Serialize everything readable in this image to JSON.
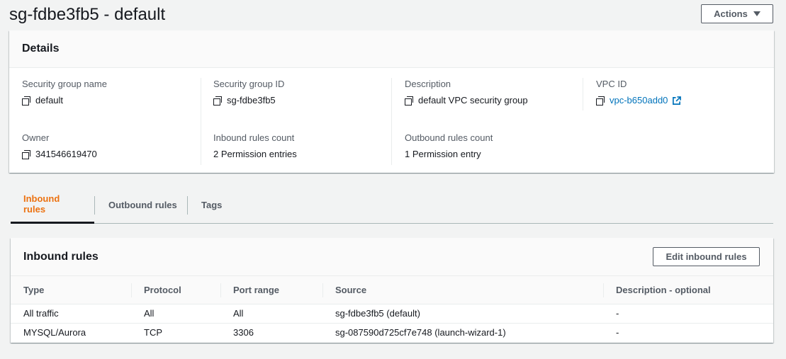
{
  "header": {
    "title": "sg-fdbe3fb5 - default",
    "actions_label": "Actions"
  },
  "details": {
    "title": "Details",
    "fields": [
      {
        "label": "Security group name",
        "value": "default"
      },
      {
        "label": "Security group ID",
        "value": "sg-fdbe3fb5"
      },
      {
        "label": "Description",
        "value": "default VPC security group"
      },
      {
        "label": "VPC ID",
        "value": "vpc-b650add0"
      },
      {
        "label": "Owner",
        "value": "341546619470"
      },
      {
        "label": "Inbound rules count",
        "value": "2 Permission entries"
      },
      {
        "label": "Outbound rules count",
        "value": "1 Permission entry"
      }
    ]
  },
  "tabs": [
    {
      "label": "Inbound rules",
      "active": true
    },
    {
      "label": "Outbound rules",
      "active": false
    },
    {
      "label": "Tags",
      "active": false
    }
  ],
  "inbound": {
    "title": "Inbound rules",
    "edit_label": "Edit inbound rules",
    "columns": [
      "Type",
      "Protocol",
      "Port range",
      "Source",
      "Description - optional"
    ],
    "rows": [
      [
        "All traffic",
        "All",
        "All",
        "sg-fdbe3fb5 (default)",
        "-"
      ],
      [
        "MYSQL/Aurora",
        "TCP",
        "3306",
        "sg-087590d725cf7e748 (launch-wizard-1)",
        "-"
      ]
    ]
  },
  "colors": {
    "accent_tab": "#ec7211",
    "link": "#0073bb"
  }
}
